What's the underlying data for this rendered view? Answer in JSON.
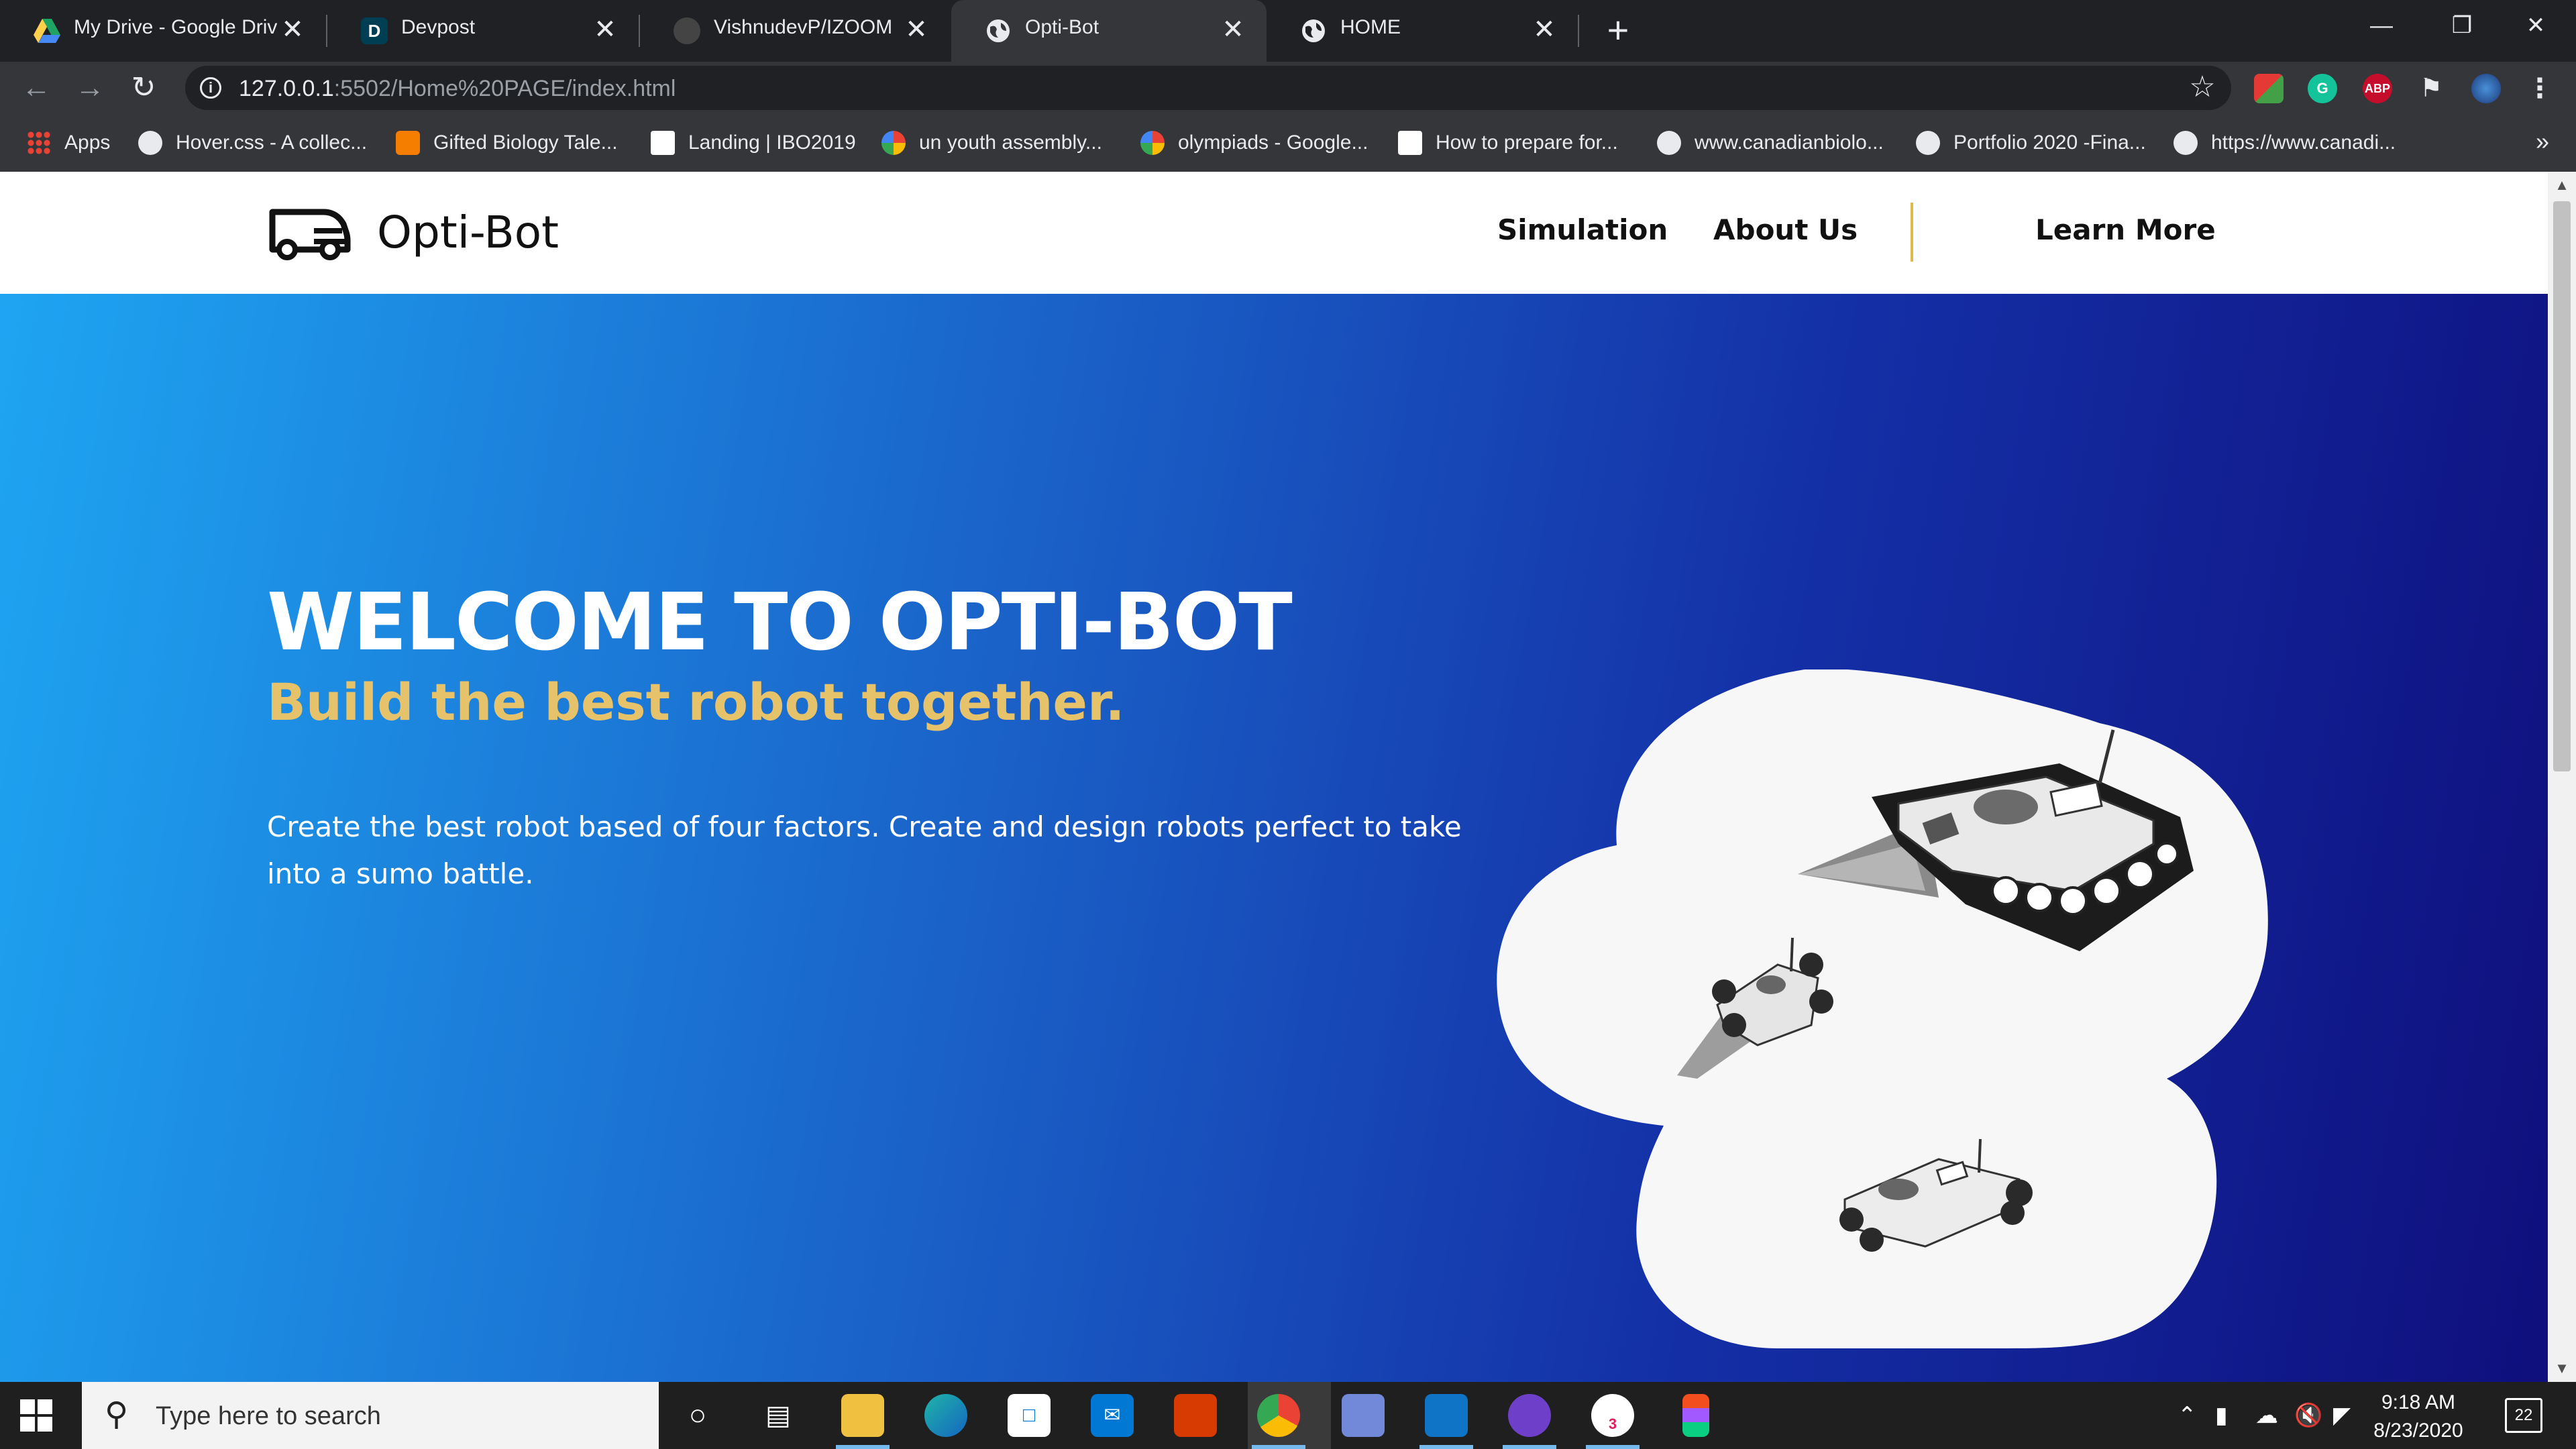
{
  "browser": {
    "tabs": [
      {
        "title": "My Drive - Google Driv",
        "icon": "google-drive-icon",
        "active": false
      },
      {
        "title": "Devpost",
        "icon": "devpost-icon",
        "active": false
      },
      {
        "title": "VishnudevP/IZOOM",
        "icon": "github-icon",
        "active": false
      },
      {
        "title": "Opti-Bot",
        "icon": "globe-icon",
        "active": true
      },
      {
        "title": "HOME",
        "icon": "globe-icon",
        "active": false
      }
    ],
    "new_tab": "+",
    "close_glyph": "✕",
    "url_host": "127.0.0.1",
    "url_path": ":5502/Home%20PAGE/index.html",
    "info_glyph": "i",
    "extensions": [
      "windows-ext-icon",
      "grammarly-icon",
      "adblock-plus-icon",
      "puzzle-extensions-icon",
      "profile-avatar-icon",
      "menu-dots-icon"
    ],
    "abp_label": "ABP",
    "grammarly_label": "G",
    "bookmarks": [
      {
        "label": "Apps",
        "icon": "apps-grid-icon"
      },
      {
        "label": "Hover.css - A collec...",
        "icon": "globe-icon"
      },
      {
        "label": "Gifted Biology Tale...",
        "icon": "blogger-icon"
      },
      {
        "label": "Landing | IBO2019",
        "icon": "ibo-icon"
      },
      {
        "label": "un youth assembly...",
        "icon": "google-icon"
      },
      {
        "label": "olympiads - Google...",
        "icon": "google-icon"
      },
      {
        "label": "How to prepare for...",
        "icon": "doc-icon"
      },
      {
        "label": "www.canadianbiolo...",
        "icon": "globe-icon"
      },
      {
        "label": "Portfolio 2020 -Fina...",
        "icon": "globe-icon"
      },
      {
        "label": "https://www.canadi...",
        "icon": "globe-icon"
      }
    ],
    "bookmarks_more": "»"
  },
  "site": {
    "brand": "Opti-Bot",
    "nav": [
      "Simulation",
      "About Us",
      "Learn More"
    ],
    "hero": {
      "title": "WELCOME TO OPTI-BOT",
      "subtitle": "Build the best robot together.",
      "description": "Create the best robot based of four factors. Create and design robots perfect to take into a sumo battle."
    },
    "colors": {
      "accent": "#e6c26a",
      "gradient_start": "#1ea5f2",
      "gradient_end": "#0f0f7d"
    }
  },
  "taskbar": {
    "search_placeholder": "Type here to search",
    "apps": [
      "cortana-icon",
      "task-view-icon",
      "file-explorer-icon",
      "edge-icon",
      "store-icon",
      "mail-icon",
      "office-icon",
      "chrome-icon",
      "discord-icon",
      "vscode-icon",
      "github-desktop-icon",
      "slack-icon",
      "figma-icon"
    ],
    "slack_badge": "3",
    "time": "9:18 AM",
    "date": "8/23/2020",
    "notification_count": "22"
  }
}
